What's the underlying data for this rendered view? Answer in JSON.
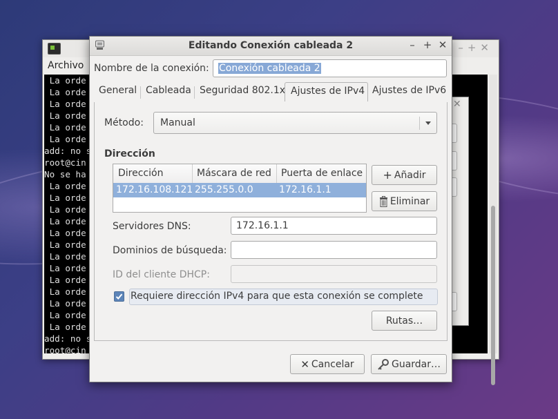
{
  "terminal": {
    "menu": "Archivo",
    "lines": [
      " La orde",
      " La orde",
      " La orde",
      " La orde",
      " La orde",
      " La orde",
      "add: no s",
      "root@cin",
      "No se ha",
      " La orde",
      " La orde",
      " La orde",
      " La orde",
      " La orde",
      " La orde",
      " La orde",
      " La orde",
      " La orde",
      " La orde",
      " La orde",
      " La orde",
      " La orde",
      "add: no s",
      "root@cin"
    ]
  },
  "dialog": {
    "title": "Editando Conexión cableada 2",
    "connection_name_label": "Nombre de la conexión:",
    "connection_name_value": "Conexión cableada 2",
    "tabs": [
      "General",
      "Cableada",
      "Seguridad 802.1x",
      "Ajustes de IPv4",
      "Ajustes de IPv6"
    ],
    "active_tab": "Ajustes de IPv4",
    "method_label": "Método:",
    "method_value": "Manual",
    "address_section": "Dirección",
    "table": {
      "headers": [
        "Dirección",
        "Máscara de red",
        "Puerta de enlace"
      ],
      "rows": [
        [
          "172.16.108.121",
          "255.255.0.0",
          "172.16.1.1"
        ]
      ]
    },
    "add_button": "Añadir",
    "delete_button": "Eliminar",
    "dns_label": "Servidores DNS:",
    "dns_value": "172.16.1.1",
    "search_domains_label": "Dominios de búsqueda:",
    "search_domains_value": "",
    "dhcp_id_label": "ID del cliente DHCP:",
    "dhcp_id_value": "",
    "require_ipv4_label": "Requiere dirección IPv4 para que esta conexión se complete",
    "require_ipv4_checked": true,
    "routes_button": "Rutas…",
    "cancel_button": "Cancelar",
    "save_button": "Guardar…"
  },
  "colors": {
    "selection": "#8fb0db",
    "checkbox": "#5c84b8"
  }
}
